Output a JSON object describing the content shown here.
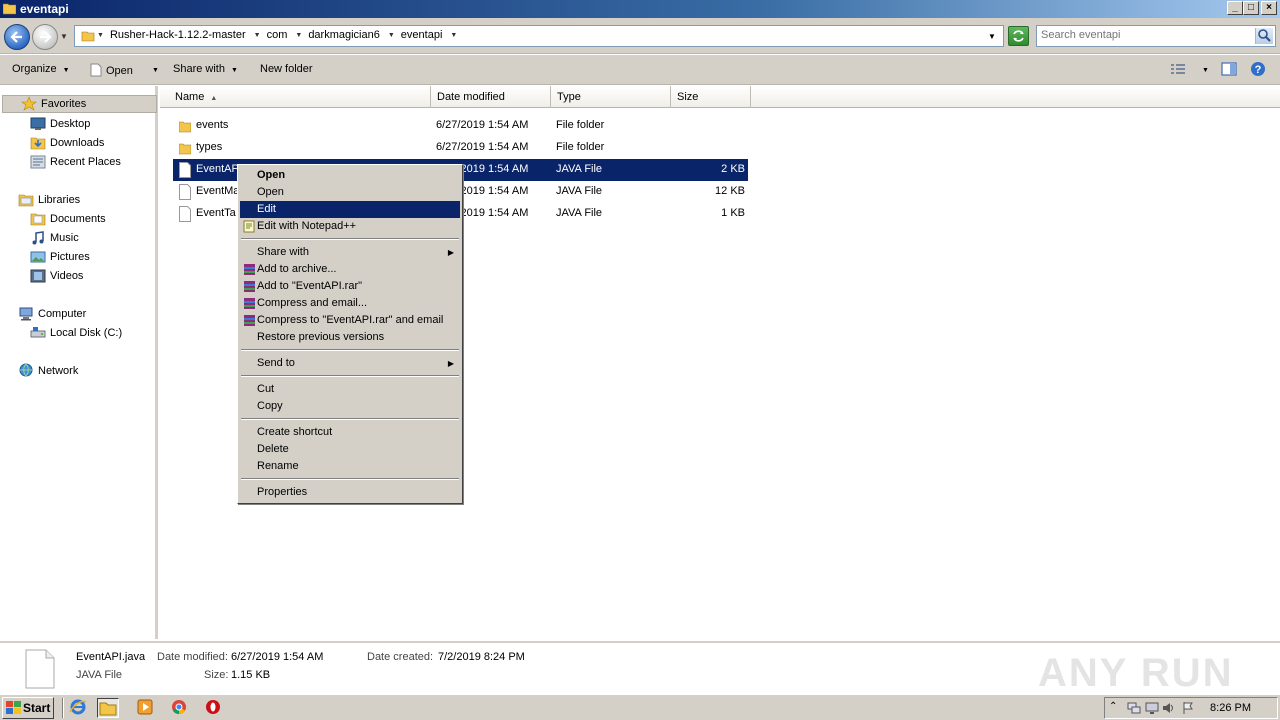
{
  "window": {
    "title": "eventapi"
  },
  "address": {
    "crumbs": [
      "Rusher-Hack-1.12.2-master",
      "com",
      "darkmagician6",
      "eventapi"
    ]
  },
  "search": {
    "placeholder": "Search eventapi"
  },
  "toolbar": {
    "organize": "Organize",
    "open": "Open",
    "share_with": "Share with",
    "new_folder": "New folder"
  },
  "nav": {
    "favorites": "Favorites",
    "desktop": "Desktop",
    "downloads": "Downloads",
    "recent": "Recent Places",
    "libraries": "Libraries",
    "documents": "Documents",
    "music": "Music",
    "pictures": "Pictures",
    "videos": "Videos",
    "computer": "Computer",
    "local_disk": "Local Disk (C:)",
    "network": "Network"
  },
  "columns": {
    "name": "Name",
    "date": "Date modified",
    "type": "Type",
    "size": "Size"
  },
  "files": [
    {
      "name": "events",
      "date": "6/27/2019 1:54 AM",
      "type": "File folder",
      "size": "",
      "kind": "folder"
    },
    {
      "name": "types",
      "date": "6/27/2019 1:54 AM",
      "type": "File folder",
      "size": "",
      "kind": "folder"
    },
    {
      "name": "EventAPI",
      "date": "6/27/2019 1:54 AM",
      "type": "JAVA File",
      "size": "2 KB",
      "kind": "file"
    },
    {
      "name": "EventMa",
      "date": "6/27/2019 1:54 AM",
      "type": "JAVA File",
      "size": "12 KB",
      "kind": "file"
    },
    {
      "name": "EventTa",
      "date": "6/27/2019 1:54 AM",
      "type": "JAVA File",
      "size": "1 KB",
      "kind": "file"
    }
  ],
  "context_menu": {
    "open_bold": "Open",
    "open": "Open",
    "edit": "Edit",
    "edit_notepad": "Edit with Notepad++",
    "share_with": "Share with",
    "add_archive": "Add to archive...",
    "add_rar": "Add to \"EventAPI.rar\"",
    "compress_email": "Compress and email...",
    "compress_rar_email": "Compress to \"EventAPI.rar\" and email",
    "restore": "Restore previous versions",
    "send_to": "Send to",
    "cut": "Cut",
    "copy": "Copy",
    "create_shortcut": "Create shortcut",
    "delete": "Delete",
    "rename": "Rename",
    "properties": "Properties"
  },
  "details": {
    "filename": "EventAPI.java",
    "modified_label": "Date modified:",
    "modified_value": "6/27/2019 1:54 AM",
    "created_label": "Date created:",
    "created_value": "7/2/2019 8:24 PM",
    "type": "JAVA File",
    "size_label": "Size:",
    "size_value": "1.15 KB"
  },
  "watermark": "ANY RUN",
  "taskbar": {
    "start": "Start",
    "clock": "8:26 PM"
  },
  "colors": {
    "selection": "#0a246a",
    "chrome": "#d4d0c8"
  }
}
